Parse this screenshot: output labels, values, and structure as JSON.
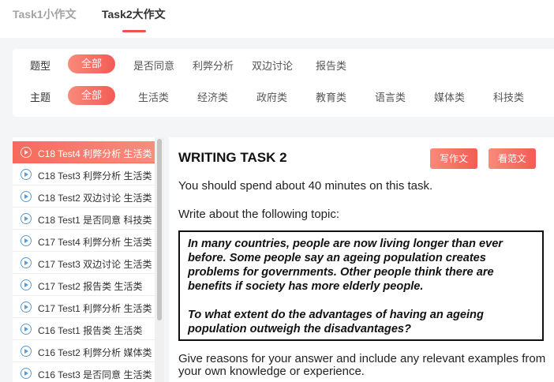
{
  "tabs": [
    {
      "label": "Task1小作文",
      "active": false
    },
    {
      "label": "Task2大作文",
      "active": true
    }
  ],
  "filters": {
    "type_label": "题型",
    "type_options": [
      "全部",
      "是否同意",
      "利弊分析",
      "双边讨论",
      "报告类"
    ],
    "topic_label": "主题",
    "topic_options": [
      "全部",
      "生活类",
      "经济类",
      "政府类",
      "教育类",
      "语言类",
      "媒体类",
      "科技类"
    ]
  },
  "list": [
    "C18 Test4 利弊分析 生活类",
    "C18 Test3 利弊分析 生活类",
    "C18 Test2 双边讨论 生活类",
    "C18 Test1 是否同意 科技类",
    "C17 Test4 利弊分析 生活类",
    "C17 Test3 双边讨论 生活类",
    "C17 Test2 报告类 生活类",
    "C17 Test1 利弊分析 生活类",
    "C16 Test1 报告类 生活类",
    "C16 Test2 利弊分析 媒体类",
    "C16 Test3 是否同意 生活类"
  ],
  "content": {
    "title": "WRITING TASK 2",
    "write_button": "写作文",
    "sample_button": "看范文",
    "instruction_time": "You should spend about 40 minutes on this task.",
    "instruction_topic": "Write about the following topic:",
    "prompt_statement": "In many countries, people are now living longer than ever before. Some people say an ageing population creates problems for governments. Other people think there are benefits if society has more elderly people.",
    "prompt_question": "To what extent do the advantages of having an ageing population outweigh the disadvantages?",
    "closing": "Give reasons for your answer and include any relevant examples from your own knowledge or experience."
  },
  "colors": {
    "accent": "#f25c55",
    "icon": "#5b9bd5"
  }
}
